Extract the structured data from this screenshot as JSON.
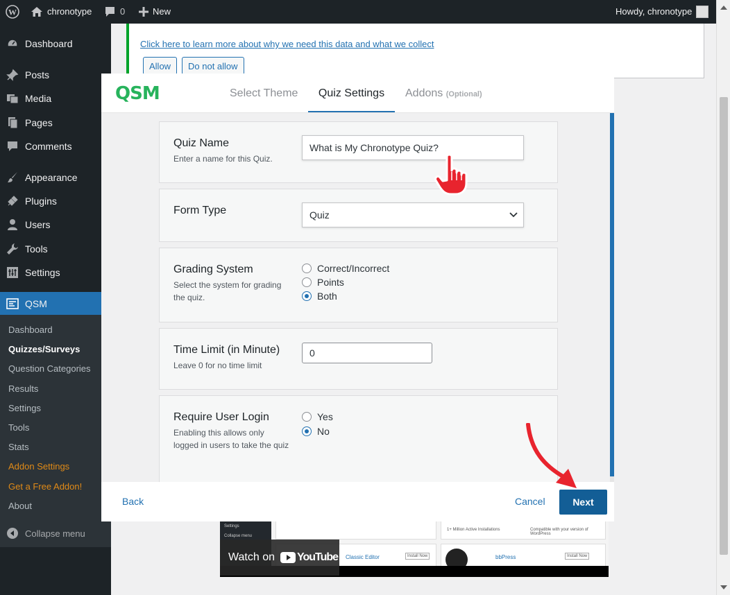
{
  "adminbar": {
    "site_name": "chronotype",
    "comments_count": "0",
    "new_label": "New",
    "howdy": "Howdy, chronotype"
  },
  "sidebar": {
    "items": [
      {
        "label": "Dashboard",
        "icon": "dashboard-icon"
      },
      {
        "label": "Posts",
        "icon": "pin-icon"
      },
      {
        "label": "Media",
        "icon": "media-icon"
      },
      {
        "label": "Pages",
        "icon": "page-icon"
      },
      {
        "label": "Comments",
        "icon": "comment-icon"
      },
      {
        "label": "Appearance",
        "icon": "brush-icon"
      },
      {
        "label": "Plugins",
        "icon": "plug-icon"
      },
      {
        "label": "Users",
        "icon": "user-icon"
      },
      {
        "label": "Tools",
        "icon": "wrench-icon"
      },
      {
        "label": "Settings",
        "icon": "settings-icon"
      },
      {
        "label": "QSM",
        "icon": "qsm-icon"
      }
    ],
    "submenu": [
      "Dashboard",
      "Quizzes/Surveys",
      "Question Categories",
      "Results",
      "Settings",
      "Tools",
      "Stats",
      "Addon Settings",
      "Get a Free Addon!",
      "About"
    ],
    "collapse": "Collapse menu"
  },
  "notice": {
    "link": "Click here to learn more about why we need this data and what we collect",
    "allow": "Allow",
    "deny": "Do not allow"
  },
  "video": {
    "watch_on": "Watch on",
    "youtube": "YouTube",
    "items": [
      "Settings",
      "Collapse menu",
      "Classic Editor",
      "bbPress",
      "Install Now",
      "Install Now",
      "1+ Million Active Installations",
      "Compatible with your version of WordPress"
    ]
  },
  "modal": {
    "logo": "QSM",
    "tabs": {
      "select_theme": "Select Theme",
      "quiz_settings": "Quiz Settings",
      "addons": "Addons",
      "addons_optional": "(Optional)"
    },
    "quiz_name": {
      "label": "Quiz Name",
      "desc": "Enter a name for this Quiz.",
      "value": "What is My Chronotype Quiz?"
    },
    "form_type": {
      "label": "Form Type",
      "value": "Quiz"
    },
    "grading": {
      "label": "Grading System",
      "desc": "Select the system for grading the quiz.",
      "options": [
        "Correct/Incorrect",
        "Points",
        "Both"
      ],
      "selected": "Both"
    },
    "time_limit": {
      "label": "Time Limit (in Minute)",
      "desc": "Leave 0 for no time limit",
      "value": "0"
    },
    "require_login": {
      "label": "Require User Login",
      "desc": "Enabling this allows only logged in users to take the quiz",
      "options": [
        "Yes",
        "No"
      ],
      "selected": "No"
    },
    "footer": {
      "back": "Back",
      "cancel": "Cancel",
      "next": "Next"
    }
  },
  "colors": {
    "accent": "#2271b1",
    "next_button": "#135e96",
    "qsm_green": "#27b35c",
    "annotation_red": "#e8242e"
  }
}
